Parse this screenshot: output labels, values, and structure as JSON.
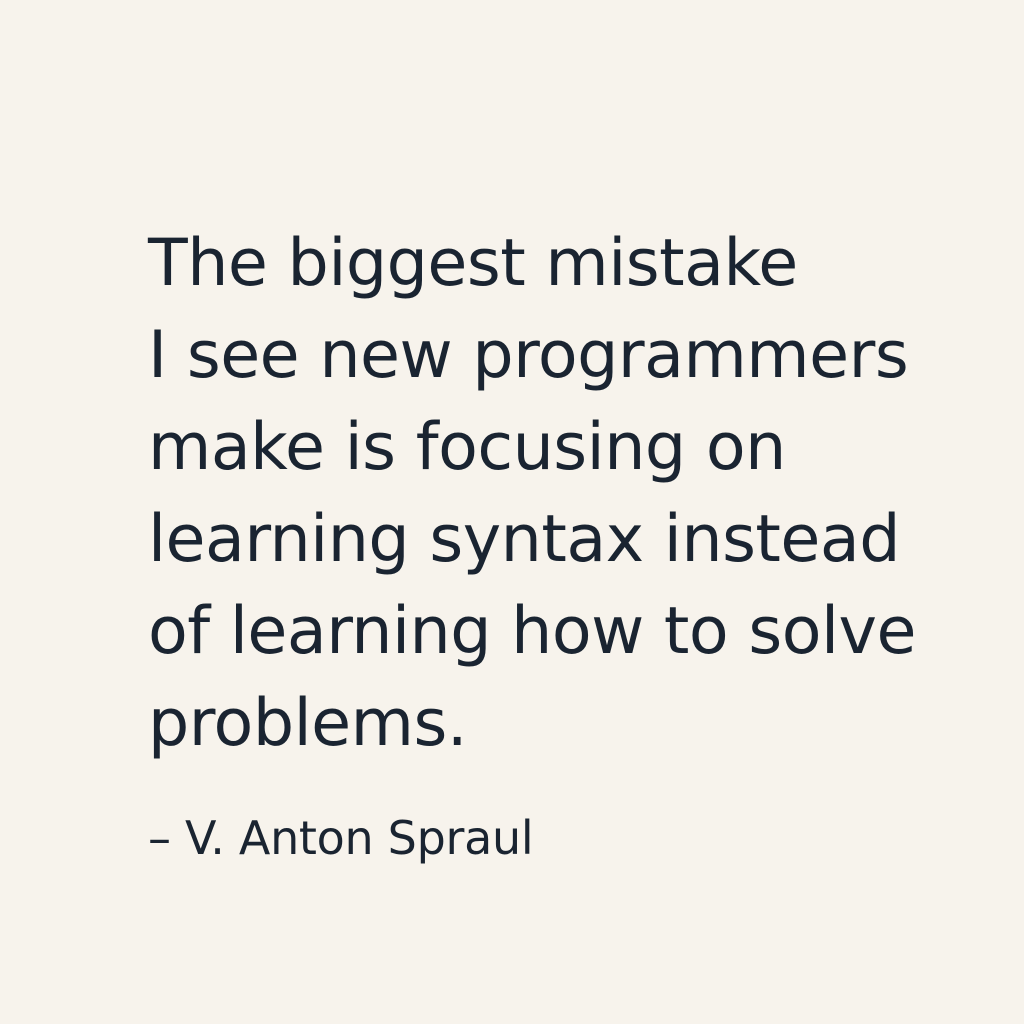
{
  "colors": {
    "background": "#f7f3ec",
    "text": "#1a2431"
  },
  "quote": {
    "lines": [
      "The biggest mistake",
      "I see new programmers",
      "make is focusing on",
      "learning syntax instead",
      "of learning how to solve",
      "problems."
    ],
    "author": "– V. Anton Spraul"
  }
}
